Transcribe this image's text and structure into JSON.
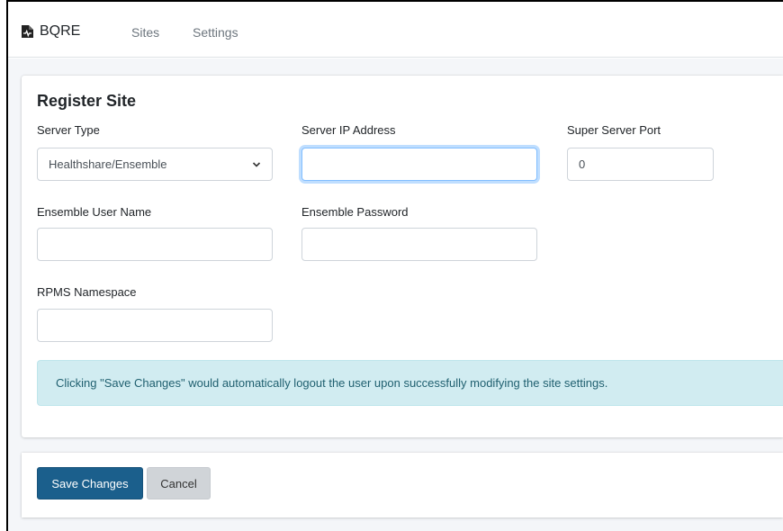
{
  "app": {
    "brand": "BQRE"
  },
  "nav": {
    "sites": "Sites",
    "settings": "Settings"
  },
  "form": {
    "title": "Register Site",
    "server_type": {
      "label": "Server Type",
      "value": "Healthshare/Ensemble"
    },
    "server_ip": {
      "label": "Server IP Address",
      "value": ""
    },
    "super_server_port": {
      "label": "Super Server Port",
      "value": "0"
    },
    "ensemble_user": {
      "label": "Ensemble User Name",
      "value": ""
    },
    "ensemble_password": {
      "label": "Ensemble Password",
      "value": ""
    },
    "rpms_namespace": {
      "label": "RPMS Namespace",
      "value": ""
    }
  },
  "alert": {
    "text": "Clicking \"Save Changes\" would automatically logout the user upon successfully modifying the site settings."
  },
  "actions": {
    "save": "Save Changes",
    "cancel": "Cancel"
  },
  "colors": {
    "primary": "#1b5f8c",
    "alert_bg": "#d1ecf1",
    "focus": "#80bdff"
  },
  "icons": {
    "brand": "file-medical-icon",
    "select": "chevron-down-icon"
  }
}
